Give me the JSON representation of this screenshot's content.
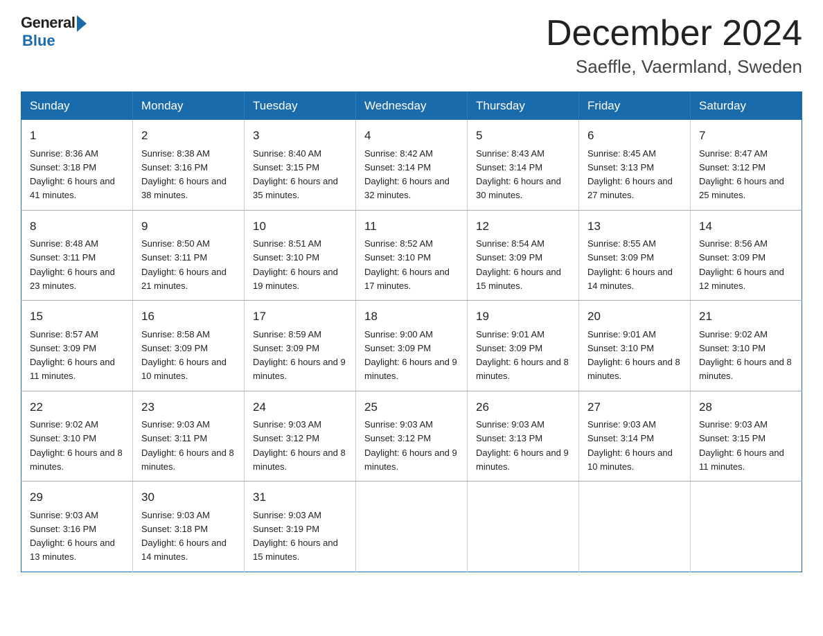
{
  "header": {
    "logo": {
      "general_text": "General",
      "blue_text": "Blue"
    },
    "title": "December 2024",
    "location": "Saeffle, Vaermland, Sweden"
  },
  "calendar": {
    "days_of_week": [
      "Sunday",
      "Monday",
      "Tuesday",
      "Wednesday",
      "Thursday",
      "Friday",
      "Saturday"
    ],
    "weeks": [
      [
        {
          "day": "1",
          "sunrise": "8:36 AM",
          "sunset": "3:18 PM",
          "daylight": "6 hours and 41 minutes."
        },
        {
          "day": "2",
          "sunrise": "8:38 AM",
          "sunset": "3:16 PM",
          "daylight": "6 hours and 38 minutes."
        },
        {
          "day": "3",
          "sunrise": "8:40 AM",
          "sunset": "3:15 PM",
          "daylight": "6 hours and 35 minutes."
        },
        {
          "day": "4",
          "sunrise": "8:42 AM",
          "sunset": "3:14 PM",
          "daylight": "6 hours and 32 minutes."
        },
        {
          "day": "5",
          "sunrise": "8:43 AM",
          "sunset": "3:14 PM",
          "daylight": "6 hours and 30 minutes."
        },
        {
          "day": "6",
          "sunrise": "8:45 AM",
          "sunset": "3:13 PM",
          "daylight": "6 hours and 27 minutes."
        },
        {
          "day": "7",
          "sunrise": "8:47 AM",
          "sunset": "3:12 PM",
          "daylight": "6 hours and 25 minutes."
        }
      ],
      [
        {
          "day": "8",
          "sunrise": "8:48 AM",
          "sunset": "3:11 PM",
          "daylight": "6 hours and 23 minutes."
        },
        {
          "day": "9",
          "sunrise": "8:50 AM",
          "sunset": "3:11 PM",
          "daylight": "6 hours and 21 minutes."
        },
        {
          "day": "10",
          "sunrise": "8:51 AM",
          "sunset": "3:10 PM",
          "daylight": "6 hours and 19 minutes."
        },
        {
          "day": "11",
          "sunrise": "8:52 AM",
          "sunset": "3:10 PM",
          "daylight": "6 hours and 17 minutes."
        },
        {
          "day": "12",
          "sunrise": "8:54 AM",
          "sunset": "3:09 PM",
          "daylight": "6 hours and 15 minutes."
        },
        {
          "day": "13",
          "sunrise": "8:55 AM",
          "sunset": "3:09 PM",
          "daylight": "6 hours and 14 minutes."
        },
        {
          "day": "14",
          "sunrise": "8:56 AM",
          "sunset": "3:09 PM",
          "daylight": "6 hours and 12 minutes."
        }
      ],
      [
        {
          "day": "15",
          "sunrise": "8:57 AM",
          "sunset": "3:09 PM",
          "daylight": "6 hours and 11 minutes."
        },
        {
          "day": "16",
          "sunrise": "8:58 AM",
          "sunset": "3:09 PM",
          "daylight": "6 hours and 10 minutes."
        },
        {
          "day": "17",
          "sunrise": "8:59 AM",
          "sunset": "3:09 PM",
          "daylight": "6 hours and 9 minutes."
        },
        {
          "day": "18",
          "sunrise": "9:00 AM",
          "sunset": "3:09 PM",
          "daylight": "6 hours and 9 minutes."
        },
        {
          "day": "19",
          "sunrise": "9:01 AM",
          "sunset": "3:09 PM",
          "daylight": "6 hours and 8 minutes."
        },
        {
          "day": "20",
          "sunrise": "9:01 AM",
          "sunset": "3:10 PM",
          "daylight": "6 hours and 8 minutes."
        },
        {
          "day": "21",
          "sunrise": "9:02 AM",
          "sunset": "3:10 PM",
          "daylight": "6 hours and 8 minutes."
        }
      ],
      [
        {
          "day": "22",
          "sunrise": "9:02 AM",
          "sunset": "3:10 PM",
          "daylight": "6 hours and 8 minutes."
        },
        {
          "day": "23",
          "sunrise": "9:03 AM",
          "sunset": "3:11 PM",
          "daylight": "6 hours and 8 minutes."
        },
        {
          "day": "24",
          "sunrise": "9:03 AM",
          "sunset": "3:12 PM",
          "daylight": "6 hours and 8 minutes."
        },
        {
          "day": "25",
          "sunrise": "9:03 AM",
          "sunset": "3:12 PM",
          "daylight": "6 hours and 9 minutes."
        },
        {
          "day": "26",
          "sunrise": "9:03 AM",
          "sunset": "3:13 PM",
          "daylight": "6 hours and 9 minutes."
        },
        {
          "day": "27",
          "sunrise": "9:03 AM",
          "sunset": "3:14 PM",
          "daylight": "6 hours and 10 minutes."
        },
        {
          "day": "28",
          "sunrise": "9:03 AM",
          "sunset": "3:15 PM",
          "daylight": "6 hours and 11 minutes."
        }
      ],
      [
        {
          "day": "29",
          "sunrise": "9:03 AM",
          "sunset": "3:16 PM",
          "daylight": "6 hours and 13 minutes."
        },
        {
          "day": "30",
          "sunrise": "9:03 AM",
          "sunset": "3:18 PM",
          "daylight": "6 hours and 14 minutes."
        },
        {
          "day": "31",
          "sunrise": "9:03 AM",
          "sunset": "3:19 PM",
          "daylight": "6 hours and 15 minutes."
        },
        null,
        null,
        null,
        null
      ]
    ]
  }
}
